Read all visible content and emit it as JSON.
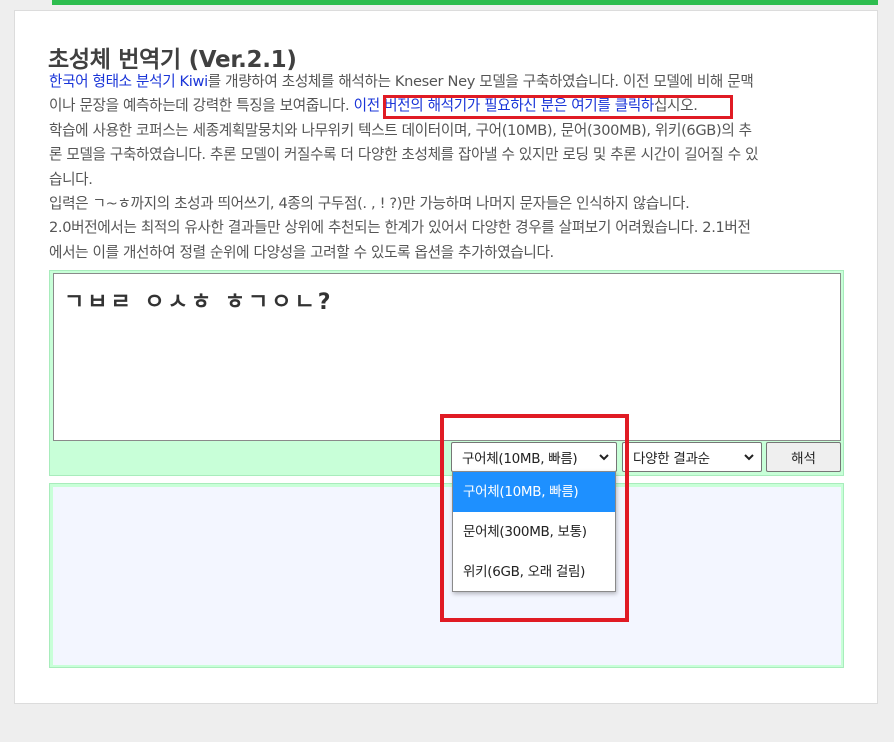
{
  "page": {
    "title": "초성체 번역기 (Ver.2.1)",
    "accent_color": "#2ebd4f",
    "highlight_color": "#e01b24"
  },
  "description": {
    "kiwi_link": "한국어 형태소 분석기 Kiwi",
    "line1_rest": "를 개량하여 초성체를 해석하는 Kneser Ney 모델을 구축하였습니다. 이전 모델에 비해 문맥",
    "line2_pre": "이나 문장을 예측하는데 강력한 특징을 보여줍니다.",
    "line2_link": "이전 버전의 해석기가 필요하신 분은 여기를 클릭하",
    "line2_post": "십시오.",
    "line3": "학습에 사용한 코퍼스는 세종계획말뭉치와 나무위키 텍스트 데이터이며, 구어(10MB), 문어(300MB), 위키(6GB)의 추",
    "line4": "론 모델을 구축하였습니다. 추론 모델이 커질수록 더 다양한 초성체를 잡아낼 수 있지만 로딩 및 추론 시간이 길어질 수 있",
    "line5": "습니다.",
    "line6": "입력은 ㄱ~ㅎ까지의 초성과 띄어쓰기, 4종의 구두점(. , ! ?)만 가능하며 나머지 문자들은 인식하지 않습니다.",
    "line7": "2.0버전에서는 최적의 유사한 결과들만 상위에 추천되는 한계가 있어서 다양한 경우를 살펴보기 어려웠습니다. 2.1버전",
    "line8": "에서는 이를 개선하여 정렬 순위에 다양성을 고려할 수 있도록 옵션을 추가하였습니다."
  },
  "input": {
    "value": "ㄱㅂㄹ ㅇㅅㅎ ㅎㄱㅇㄴ?"
  },
  "controls": {
    "model_selected": "구어체(10MB, 빠름)",
    "model_options": [
      "구어체(10MB, 빠름)",
      "문어체(300MB, 보통)",
      "위키(6GB, 오래 걸림)"
    ],
    "order_selected": "다양한 결과순",
    "translate_label": "해석"
  }
}
